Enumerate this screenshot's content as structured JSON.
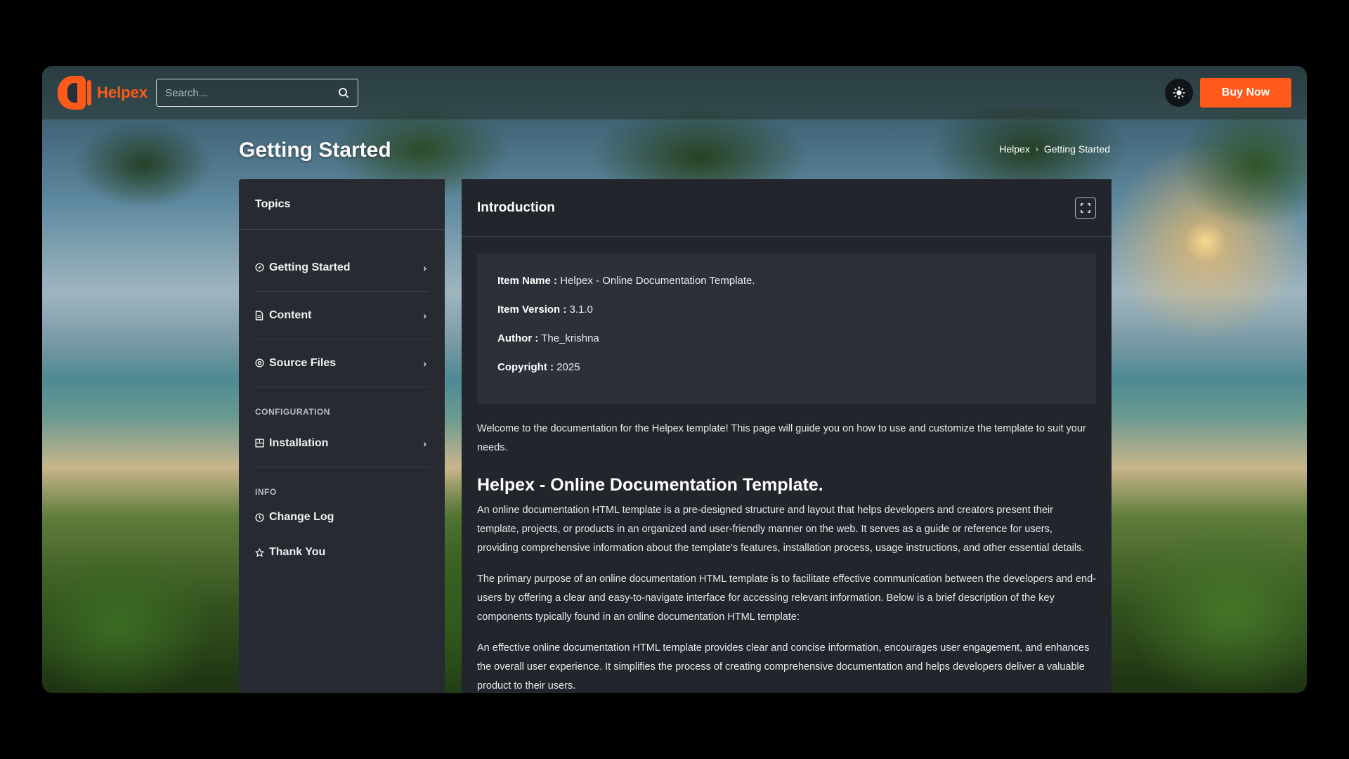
{
  "header": {
    "brand": "Helpex",
    "search_placeholder": "Search...",
    "buy_label": "Buy Now"
  },
  "page": {
    "title": "Getting Started",
    "breadcrumb": [
      "Helpex",
      "Getting Started"
    ]
  },
  "sidebar": {
    "title": "Topics",
    "items": [
      {
        "label": "Getting Started",
        "icon": "compass-icon"
      },
      {
        "label": "Content",
        "icon": "document-icon"
      },
      {
        "label": "Source Files",
        "icon": "at-icon"
      }
    ],
    "config_section": "CONFIGURATION",
    "config_items": [
      {
        "label": "Installation",
        "icon": "install-icon"
      }
    ],
    "info_section": "INFO",
    "info_items": [
      {
        "label": "Change Log",
        "icon": "clock-icon"
      },
      {
        "label": "Thank You",
        "icon": "star-icon"
      }
    ]
  },
  "main": {
    "title": "Introduction",
    "info": [
      {
        "key": "Item Name :",
        "value": " Helpex - Online Documentation Template."
      },
      {
        "key": "Item Version :",
        "value": " 3.1.0"
      },
      {
        "key": "Author :",
        "value": " The_krishna"
      },
      {
        "key": "Copyright :",
        "value": " 2025"
      }
    ],
    "intro": "Welcome to the documentation for the Helpex template! This page will guide you on how to use and customize the template to suit your needs.",
    "heading": "Helpex - Online Documentation Template.",
    "paragraphs": [
      "An online documentation HTML template is a pre-designed structure and layout that helps developers and creators present their template, projects, or products in an organized and user-friendly manner on the web. It serves as a guide or reference for users, providing comprehensive information about the template's features, installation process, usage instructions, and other essential details.",
      "The primary purpose of an online documentation HTML template is to facilitate effective communication between the developers and end-users by offering a clear and easy-to-navigate interface for accessing relevant information. Below is a brief description of the key components typically found in an online documentation HTML template:",
      "An effective online documentation HTML template provides clear and concise information, encourages user engagement, and enhances the overall user experience. It simplifies the process of creating comprehensive documentation and helps developers deliver a valuable product to their users."
    ]
  },
  "colors": {
    "accent": "#ff5a1a",
    "panel": "#272a31",
    "content": "#22252b"
  }
}
